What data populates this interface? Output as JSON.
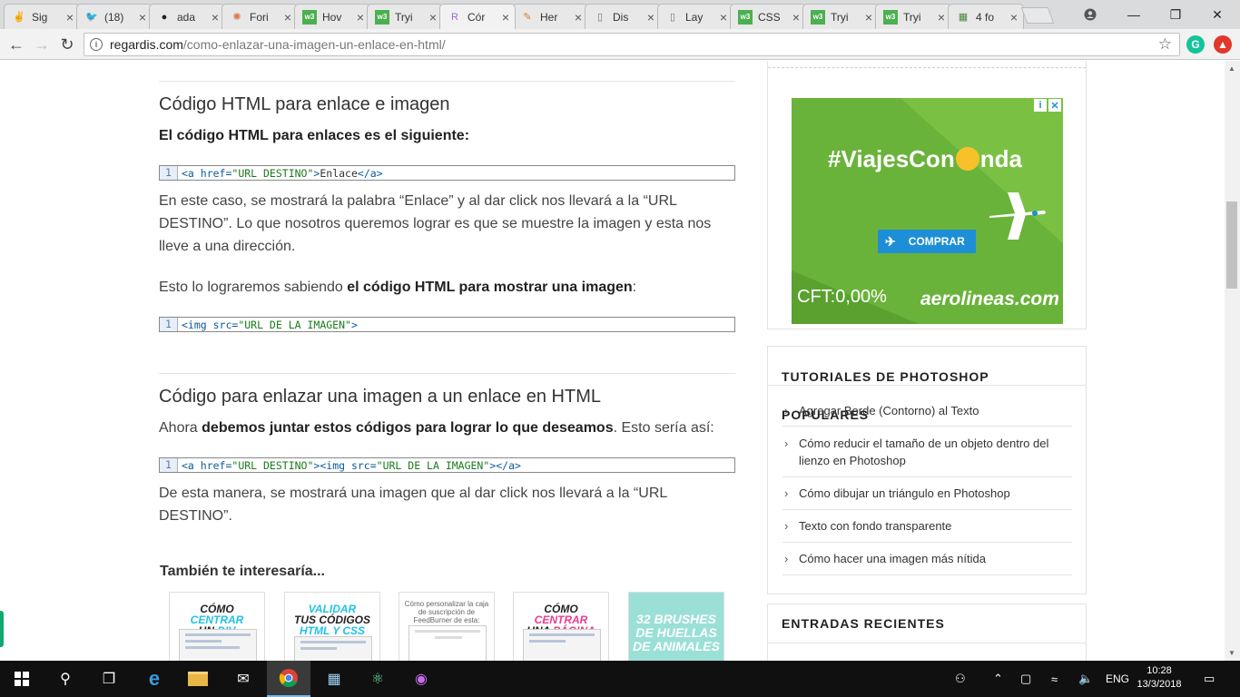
{
  "browser": {
    "tabs": [
      {
        "title": "Sig",
        "icon": "hand-peace-icon"
      },
      {
        "title": "(18)",
        "icon": "twitter-bird-icon"
      },
      {
        "title": "ada",
        "icon": "github-icon"
      },
      {
        "title": "Fori",
        "icon": "cookie-icon"
      },
      {
        "title": "Hov",
        "icon": "w3schools-icon"
      },
      {
        "title": "Tryi",
        "icon": "w3schools-icon"
      },
      {
        "title": "Cór",
        "icon": "regardis-icon",
        "active": true
      },
      {
        "title": "Her",
        "icon": "pencil-icon"
      },
      {
        "title": "Dis",
        "icon": "document-icon"
      },
      {
        "title": "Lay",
        "icon": "document-icon"
      },
      {
        "title": "CSS",
        "icon": "w3schools-icon"
      },
      {
        "title": "Tryi",
        "icon": "w3schools-icon"
      },
      {
        "title": "Tryi",
        "icon": "w3schools-icon"
      },
      {
        "title": "4 fo",
        "icon": "spreadsheet-icon"
      }
    ],
    "url_domain": "regardis.com",
    "url_path": "/como-enlazar-una-imagen-un-enlace-en-html/",
    "ext_grammarly": "G"
  },
  "article": {
    "h1": "Código HTML para enlace e imagen",
    "p1": "El código HTML para enlaces es el siguiente:",
    "code1": {
      "ln": "1",
      "open": "<a href=",
      "str": "\"URL DESTINO\"",
      "close": ">",
      "text": "Enlace",
      "end": "</a>"
    },
    "p2": "En este caso, se mostrará la palabra “Enlace” y al dar click nos llevará a la “URL DESTINO”. Lo que nosotros queremos lograr es que se muestre la imagen y esta nos lleve a una dirección.",
    "p3_pre": "Esto lo lograremos sabiendo ",
    "p3_bold": "el código HTML para mostrar una imagen",
    "p3_post": ":",
    "code2": {
      "ln": "1",
      "open": "<img src=",
      "str": "\"URL DE LA IMAGEN\"",
      "close": ">"
    },
    "h2": "Código para enlazar una imagen a un enlace en HTML",
    "p4_pre": "Ahora ",
    "p4_bold": "debemos juntar estos códigos para lograr lo que deseamos",
    "p4_post": ". Esto sería así:",
    "code3": {
      "ln": "1",
      "a_open": "<a href=",
      "a_str": "\"URL DESTINO\"",
      "a_close": ">",
      "img_open": "<img src=",
      "img_str": "\"URL DE LA IMAGEN\"",
      "img_close": ">",
      "end": "</a>"
    },
    "p5": "De esta manera, se mostrará una imagen que al dar click nos llevará a la “URL DESTINO”.",
    "related_title": "También te interesaría...",
    "related": [
      {
        "l1": "CÓMO ",
        "l1b": "CENTRAR",
        "l2": "UN ",
        "l2b": "DIV"
      },
      {
        "l1": "VALIDAR",
        "l1b": "",
        "l2": "TUS CÓDIGOS",
        "l2b": "HTML Y CSS"
      },
      {
        "l1": "Cómo personalizar la caja de suscripción de FeedBurner de esta:",
        "l1b": "",
        "l2": "",
        "l2b": ""
      },
      {
        "l1": "CÓMO ",
        "l1b": "CENTRAR",
        "l2": "UNA ",
        "l2b": "PÁGINA WEB"
      },
      {
        "l1": "32 BRUSHES",
        "l1b": "",
        "l2": "DE HUELLAS",
        "l2b": "DE ANIMALES"
      }
    ]
  },
  "sidebar": {
    "ad": {
      "hashtag_pre": "#ViajesCon",
      "hashtag_post": "nda",
      "cta": "COMPRAR",
      "cft": "CFT:0,00%",
      "brand": "aerolineas.com"
    },
    "popular_title": "TUTORIALES DE PHOTOSHOP POPULARES",
    "popular": [
      "Agregar Borde (Contorno) al Texto",
      "Cómo reducir el tamaño de un objeto dentro del lienzo en Photoshop",
      "Cómo dibujar un triángulo en Photoshop",
      "Texto con fondo transparente",
      "Cómo hacer una imagen más nítida"
    ],
    "recent_title": "ENTRADAS RECIENTES"
  },
  "taskbar": {
    "lang": "ENG",
    "time": "10:28",
    "date": "13/3/2018"
  }
}
